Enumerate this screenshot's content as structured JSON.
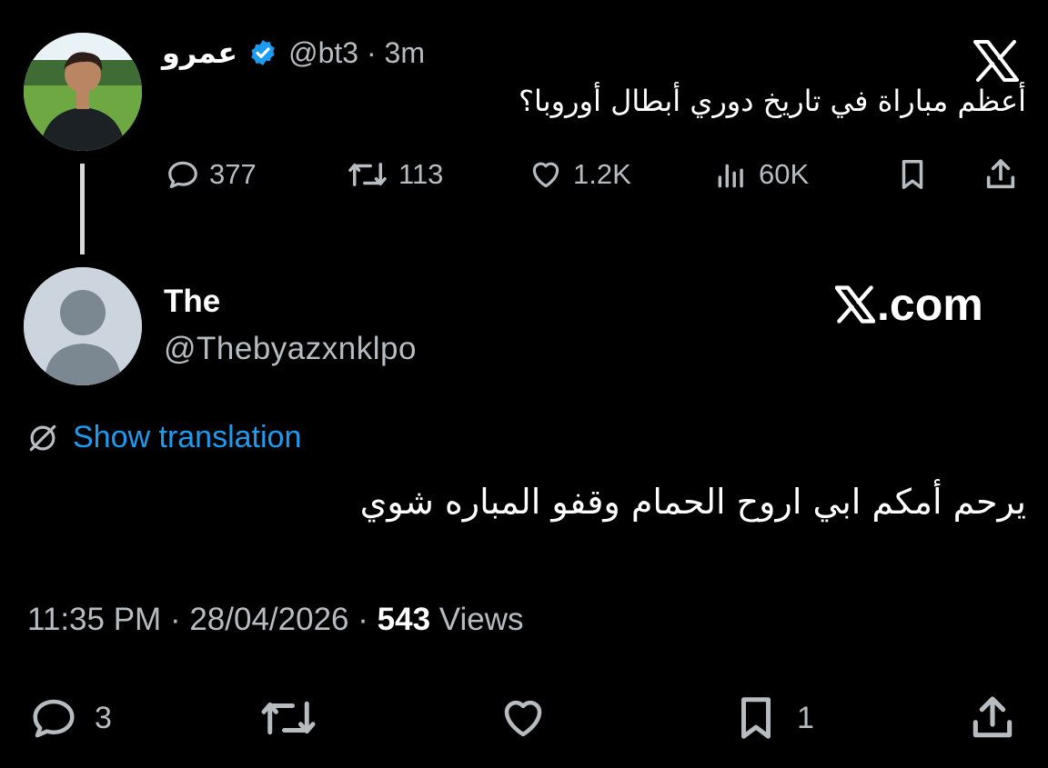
{
  "tweet": {
    "author_name": "عمرو",
    "handle": "@bt3",
    "separator": "·",
    "time": "3m",
    "text": "أعظم مباراة في تاريخ دوري أبطال أوروبا؟",
    "metrics": {
      "replies": "377",
      "reposts": "113",
      "likes": "1.2K",
      "views": "60K"
    }
  },
  "reply": {
    "author_name": "The",
    "handle": "@Thebyazxnklpo",
    "brand": ".com",
    "show_translation": "Show translation",
    "text": "يرحم أمكم ابي اروح الحمام وقفو المباره شوي",
    "time": "11:35 PM",
    "separator": "·",
    "date": "28/04/2026",
    "separator2": "·",
    "views_count": "543",
    "views_label": "Views",
    "actions": {
      "replies": "3",
      "bookmarks": "1"
    }
  },
  "colors": {
    "background": "#000000",
    "verified": "#1d9bf0",
    "link": "#1d9bf0",
    "muted": "#b7bcc1"
  }
}
